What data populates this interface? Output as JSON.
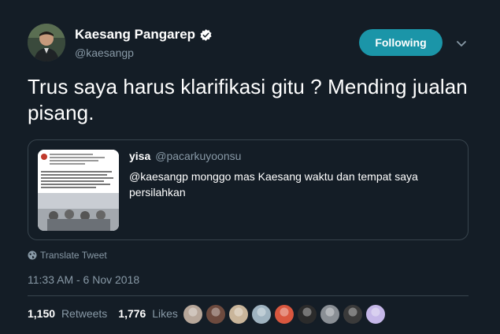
{
  "user": {
    "name": "Kaesang Pangarep",
    "handle": "@kaesangp"
  },
  "follow_label": "Following",
  "tweet_text": "Trus saya harus klarifikasi gitu ? Mending jualan pisang.",
  "quoted": {
    "name": "yisa",
    "handle": "@pacarkuyoonsu",
    "text": "@kaesangp monggo mas Kaesang waktu dan tempat saya persilahkan"
  },
  "translate_label": "Translate Tweet",
  "timestamp": "11:33 AM - 6 Nov 2018",
  "stats": {
    "retweets_count": "1,150",
    "retweets_label": "Retweets",
    "likes_count": "1,776",
    "likes_label": "Likes"
  },
  "colors": {
    "background": "#141d26",
    "accent": "#1b95a8",
    "muted": "#8899a6",
    "border": "#38444d"
  },
  "liker_colors": [
    "#b7a79a",
    "#6d4a3e",
    "#c9b59a",
    "#9fb3c0",
    "#d9573f",
    "#2b2b2b",
    "#8a8f95",
    "#3a3a3a",
    "#c5b7e8"
  ]
}
